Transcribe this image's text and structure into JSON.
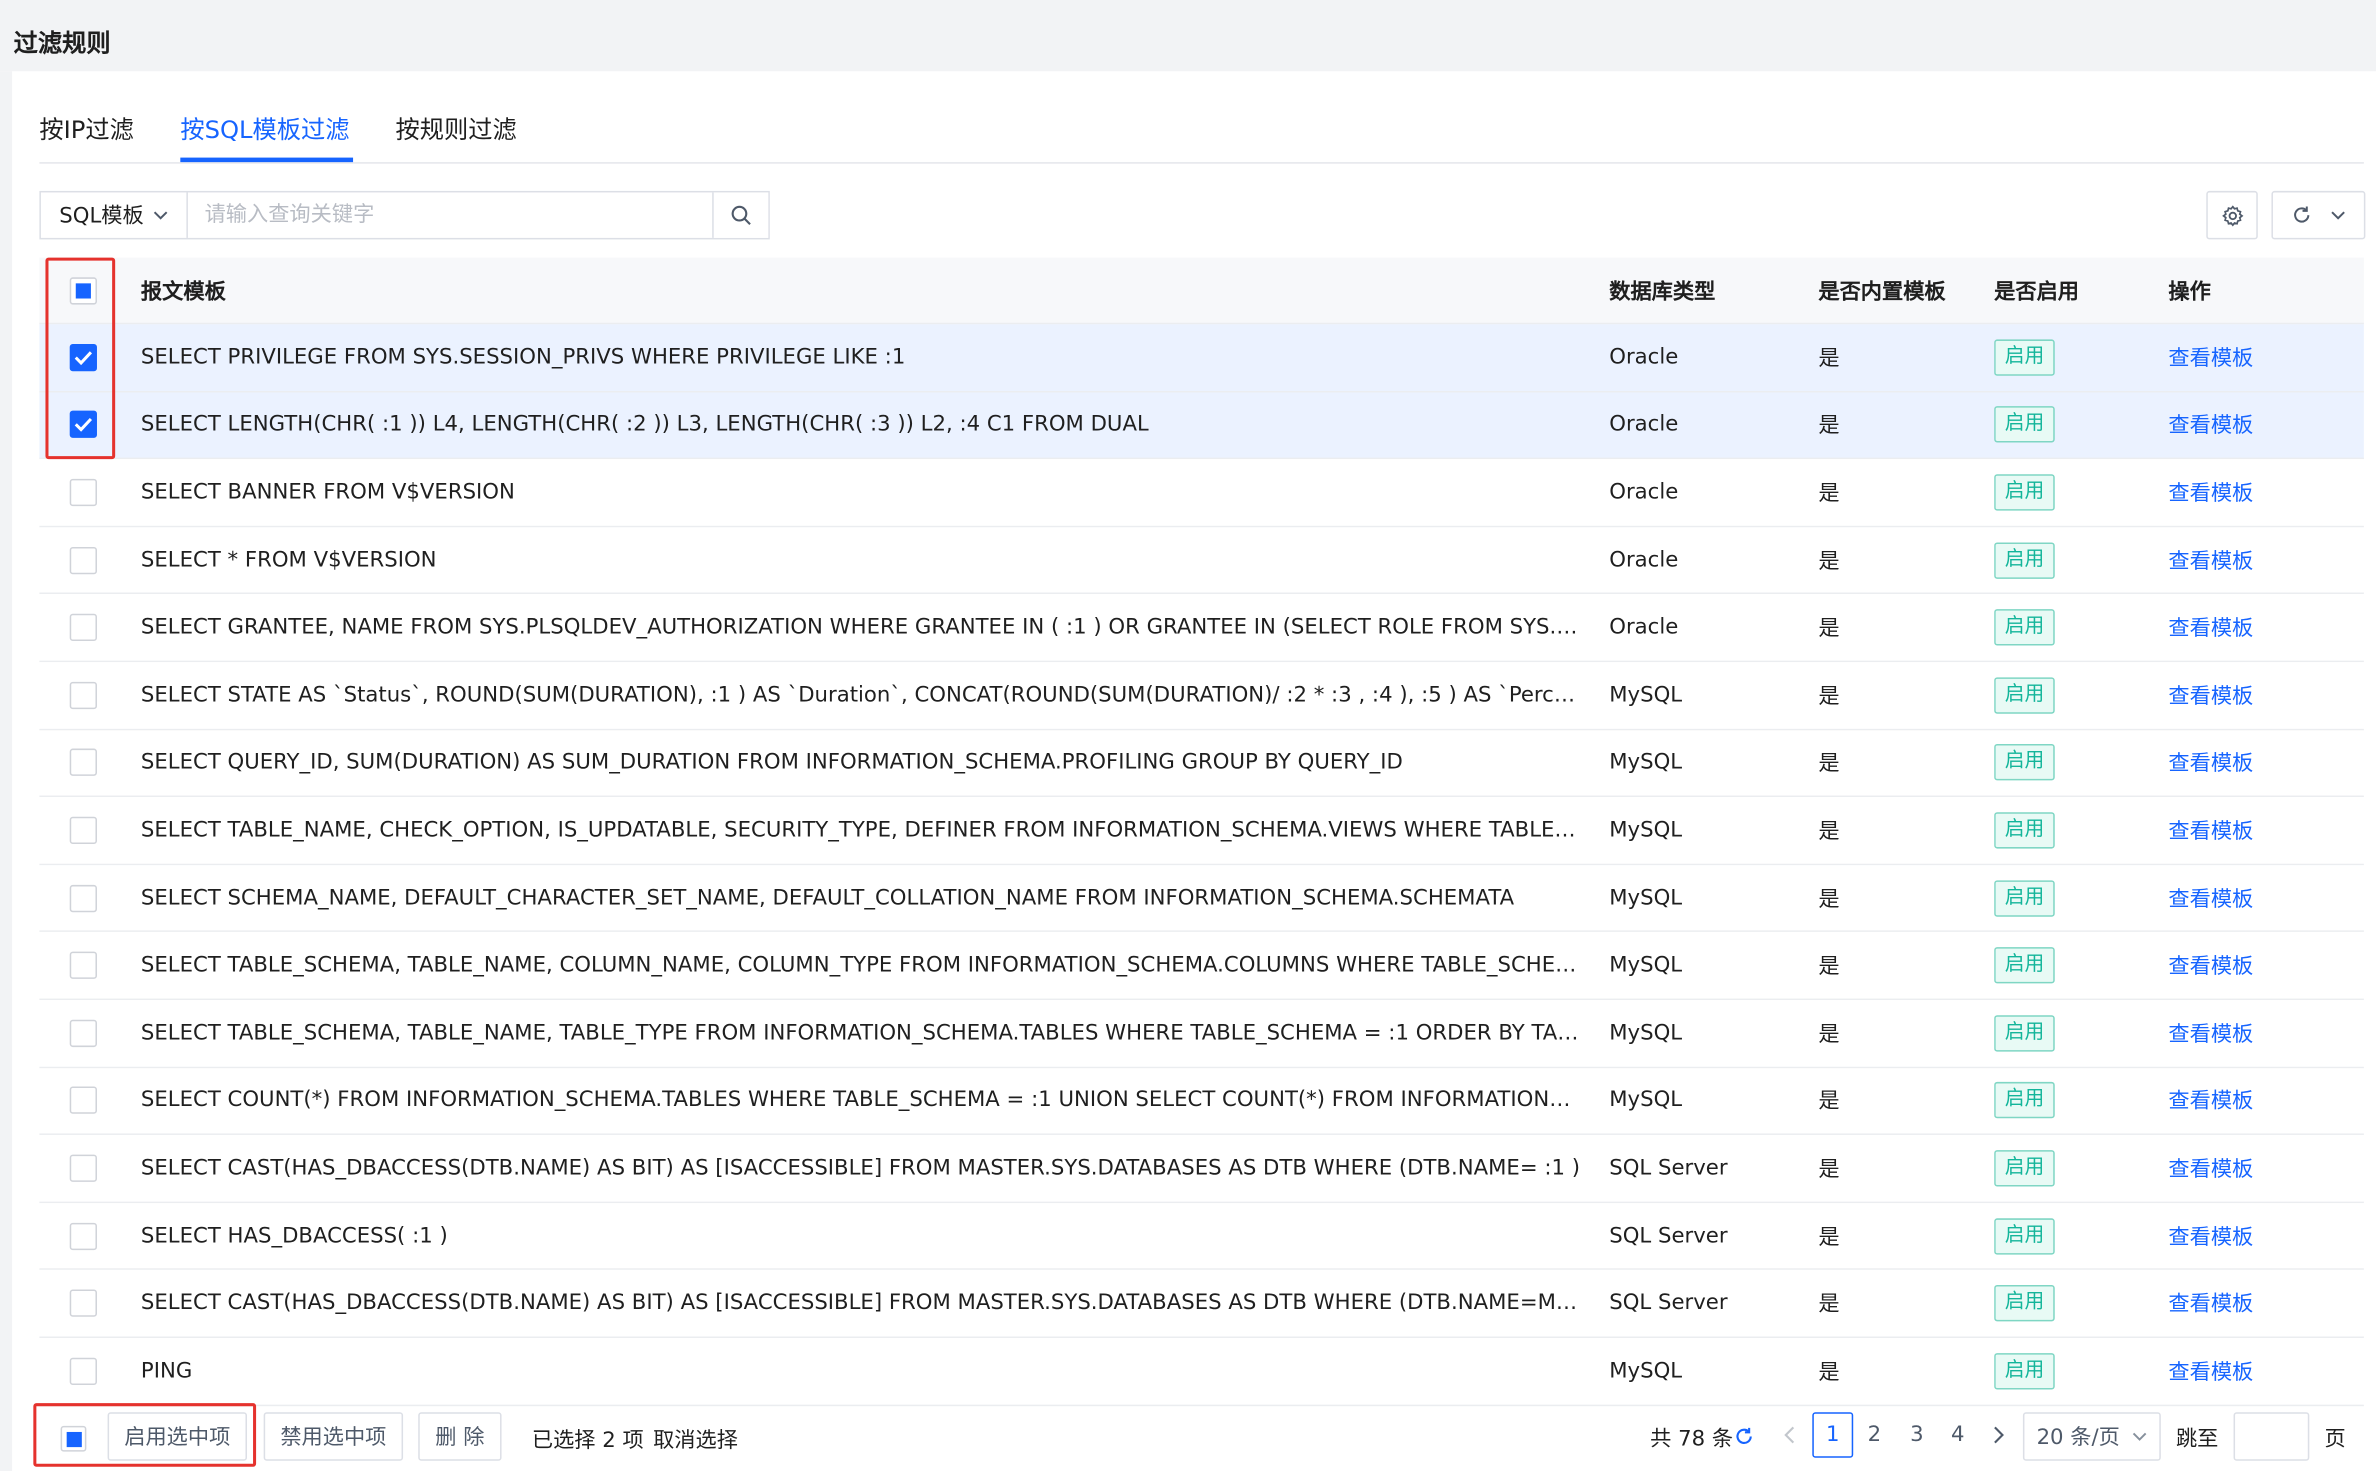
{
  "page_title": "过滤规则",
  "tabs": [
    {
      "label": "按IP过滤",
      "active": false
    },
    {
      "label": "按SQL模板过滤",
      "active": true
    },
    {
      "label": "按规则过滤",
      "active": false
    }
  ],
  "search": {
    "field_select": "SQL模板",
    "placeholder": "请输入查询关键字",
    "value": ""
  },
  "toolbar": {
    "settings_icon": "gear-icon",
    "refresh_icon": "refresh-icon",
    "dropdown_icon": "chevron-down-icon"
  },
  "table": {
    "headers": {
      "template": "报文模板",
      "db_type": "数据库类型",
      "builtin": "是否内置模板",
      "enabled": "是否启用",
      "action": "操作"
    },
    "select_all_state": "indeterminate",
    "rows": [
      {
        "checked": true,
        "template": "SELECT PRIVILEGE FROM SYS.SESSION_PRIVS WHERE PRIVILEGE LIKE :1",
        "db_type": "Oracle",
        "builtin": "是",
        "enabled": "启用",
        "action": "查看模板"
      },
      {
        "checked": true,
        "template": "SELECT LENGTH(CHR( :1 )) L4, LENGTH(CHR( :2 )) L3, LENGTH(CHR( :3 )) L2, :4 C1 FROM DUAL",
        "db_type": "Oracle",
        "builtin": "是",
        "enabled": "启用",
        "action": "查看模板"
      },
      {
        "checked": false,
        "template": "SELECT BANNER FROM V$VERSION",
        "db_type": "Oracle",
        "builtin": "是",
        "enabled": "启用",
        "action": "查看模板"
      },
      {
        "checked": false,
        "template": "SELECT * FROM V$VERSION",
        "db_type": "Oracle",
        "builtin": "是",
        "enabled": "启用",
        "action": "查看模板"
      },
      {
        "checked": false,
        "template": "SELECT GRANTEE, NAME FROM SYS.PLSQLDEV_AUTHORIZATION WHERE GRANTEE IN ( :1 ) OR GRANTEE IN (SELECT ROLE FROM SYS.S…",
        "db_type": "Oracle",
        "builtin": "是",
        "enabled": "启用",
        "action": "查看模板"
      },
      {
        "checked": false,
        "template": "SELECT STATE AS `Status`, ROUND(SUM(DURATION), :1 ) AS `Duration`, CONCAT(ROUND(SUM(DURATION)/ :2 * :3 , :4 ), :5 ) AS `Percentage` FR…",
        "db_type": "MySQL",
        "builtin": "是",
        "enabled": "启用",
        "action": "查看模板"
      },
      {
        "checked": false,
        "template": "SELECT QUERY_ID, SUM(DURATION) AS SUM_DURATION FROM INFORMATION_SCHEMA.PROFILING GROUP BY QUERY_ID",
        "db_type": "MySQL",
        "builtin": "是",
        "enabled": "启用",
        "action": "查看模板"
      },
      {
        "checked": false,
        "template": "SELECT TABLE_NAME, CHECK_OPTION, IS_UPDATABLE, SECURITY_TYPE, DEFINER FROM INFORMATION_SCHEMA.VIEWS WHERE TABLE_…",
        "db_type": "MySQL",
        "builtin": "是",
        "enabled": "启用",
        "action": "查看模板"
      },
      {
        "checked": false,
        "template": "SELECT SCHEMA_NAME, DEFAULT_CHARACTER_SET_NAME, DEFAULT_COLLATION_NAME FROM INFORMATION_SCHEMA.SCHEMATA",
        "db_type": "MySQL",
        "builtin": "是",
        "enabled": "启用",
        "action": "查看模板"
      },
      {
        "checked": false,
        "template": "SELECT TABLE_SCHEMA, TABLE_NAME, COLUMN_NAME, COLUMN_TYPE FROM INFORMATION_SCHEMA.COLUMNS WHERE TABLE_SCHE…",
        "db_type": "MySQL",
        "builtin": "是",
        "enabled": "启用",
        "action": "查看模板"
      },
      {
        "checked": false,
        "template": "SELECT TABLE_SCHEMA, TABLE_NAME, TABLE_TYPE FROM INFORMATION_SCHEMA.TABLES WHERE TABLE_SCHEMA = :1 ORDER BY TABL…",
        "db_type": "MySQL",
        "builtin": "是",
        "enabled": "启用",
        "action": "查看模板"
      },
      {
        "checked": false,
        "template": "SELECT COUNT(*) FROM INFORMATION_SCHEMA.TABLES WHERE TABLE_SCHEMA = :1 UNION SELECT COUNT(*) FROM INFORMATION_SC…",
        "db_type": "MySQL",
        "builtin": "是",
        "enabled": "启用",
        "action": "查看模板"
      },
      {
        "checked": false,
        "template": "SELECT CAST(HAS_DBACCESS(DTB.NAME) AS BIT) AS [ISACCESSIBLE] FROM MASTER.SYS.DATABASES AS DTB WHERE (DTB.NAME= :1 )",
        "db_type": "SQL Server",
        "builtin": "是",
        "enabled": "启用",
        "action": "查看模板"
      },
      {
        "checked": false,
        "template": "SELECT HAS_DBACCESS( :1 )",
        "db_type": "SQL Server",
        "builtin": "是",
        "enabled": "启用",
        "action": "查看模板"
      },
      {
        "checked": false,
        "template": "SELECT CAST(HAS_DBACCESS(DTB.NAME) AS BIT) AS [ISACCESSIBLE] FROM MASTER.SYS.DATABASES AS DTB WHERE (DTB.NAME=MAST…",
        "db_type": "SQL Server",
        "builtin": "是",
        "enabled": "启用",
        "action": "查看模板"
      },
      {
        "checked": false,
        "template": "PING",
        "db_type": "MySQL",
        "builtin": "是",
        "enabled": "启用",
        "action": "查看模板"
      }
    ]
  },
  "bulk_actions": {
    "enable_selected": "启用选中项",
    "disable_selected": "禁用选中项",
    "delete": "删 除",
    "selected_count": "已选择 2 项",
    "cancel_selection": "取消选择"
  },
  "pagination": {
    "total": "共 78 条",
    "pages": [
      "1",
      "2",
      "3",
      "4"
    ],
    "current_page": "1",
    "page_size": "20 条/页",
    "jump_label": "跳至",
    "jump_value": "",
    "page_suffix": "页"
  },
  "colors": {
    "accent": "#1664ff",
    "badge_text": "#13b59a",
    "badge_border": "#7fd6c4",
    "selected_row": "#ebf2ff",
    "highlight_box": "#e5322d"
  }
}
